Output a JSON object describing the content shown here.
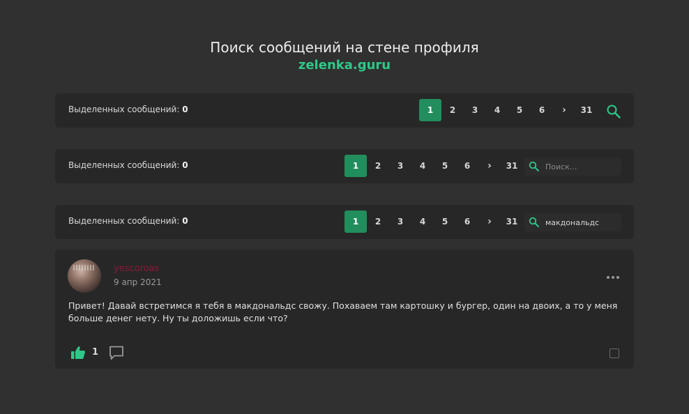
{
  "header": {
    "title": "Поиск сообщений на стене профиля",
    "subtitle": "zelenka.guru"
  },
  "colors": {
    "accent": "#228e5d",
    "brand": "#2fc889",
    "background": "#303030",
    "panel": "#272727"
  },
  "bars": [
    {
      "label": "Выделенных сообщений:",
      "count": "0",
      "pages": [
        "1",
        "2",
        "3",
        "4",
        "5",
        "6"
      ],
      "next": "›",
      "last": "31",
      "active_page": "1",
      "search": {
        "type": "icon-button",
        "icon": "search-icon"
      }
    },
    {
      "label": "Выделенных сообщений:",
      "count": "0",
      "pages": [
        "1",
        "2",
        "3",
        "4",
        "5",
        "6"
      ],
      "next": "›",
      "last": "31",
      "active_page": "1",
      "search": {
        "type": "input",
        "icon": "search-icon",
        "placeholder": "Поиск...",
        "value": ""
      }
    },
    {
      "label": "Выделенных сообщений:",
      "count": "0",
      "pages": [
        "1",
        "2",
        "3",
        "4",
        "5",
        "6"
      ],
      "next": "›",
      "last": "31",
      "active_page": "1",
      "search": {
        "type": "input",
        "icon": "search-icon",
        "placeholder": "Поиск...",
        "value": "макдональдс"
      }
    }
  ],
  "post": {
    "username": "yescoroas",
    "date": "9 апр 2021",
    "text": "Привет! Давай встретимся я тебя в макдональдс свожу. Похаваем там картошку и бургер, один на двоих, а то у меня больше денег нету. Ну ты доложишь если что?",
    "likes": "1",
    "icons": {
      "menu": "more-dots-icon",
      "like": "thumbs-up-icon",
      "comment": "comment-icon",
      "select": "checkbox-icon"
    }
  }
}
